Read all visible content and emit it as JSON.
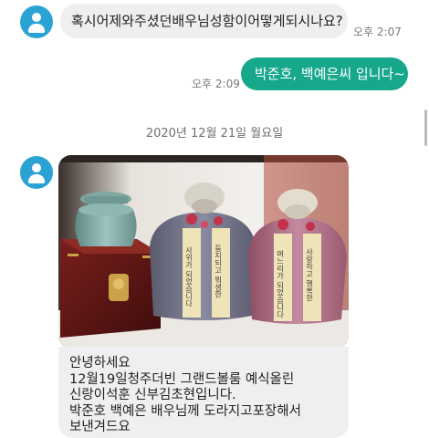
{
  "messages": [
    {
      "text": "혹시어제와주셨던배우님성함이어떻게되시나요?",
      "time": "오후 2:07"
    },
    {
      "text": "박준호, 백예은씨 입니다~",
      "time": "오후 2:09"
    }
  ],
  "date_separator": "2020년 12월 21일 월요일",
  "photo_message": {
    "ribbon_left_1": "사위가 되었습니다",
    "ribbon_left_2": "둥지되고 뭐생한",
    "ribbon_right_1": "며느리가 되었습니다",
    "ribbon_right_2": "사랑하고 행복한",
    "lines": [
      "안녕하세요",
      "12월19일청주더빈 그랜드볼룸 예식올린",
      "신랑이석훈 신부김초현입니다.",
      "박준호 백예은 배우님께 도라지고포장해서",
      "보낸겨드요"
    ]
  },
  "colors": {
    "outgoing_bubble": "#17a88c",
    "incoming_bubble": "#efefef",
    "avatar": "#2aa3d4"
  }
}
